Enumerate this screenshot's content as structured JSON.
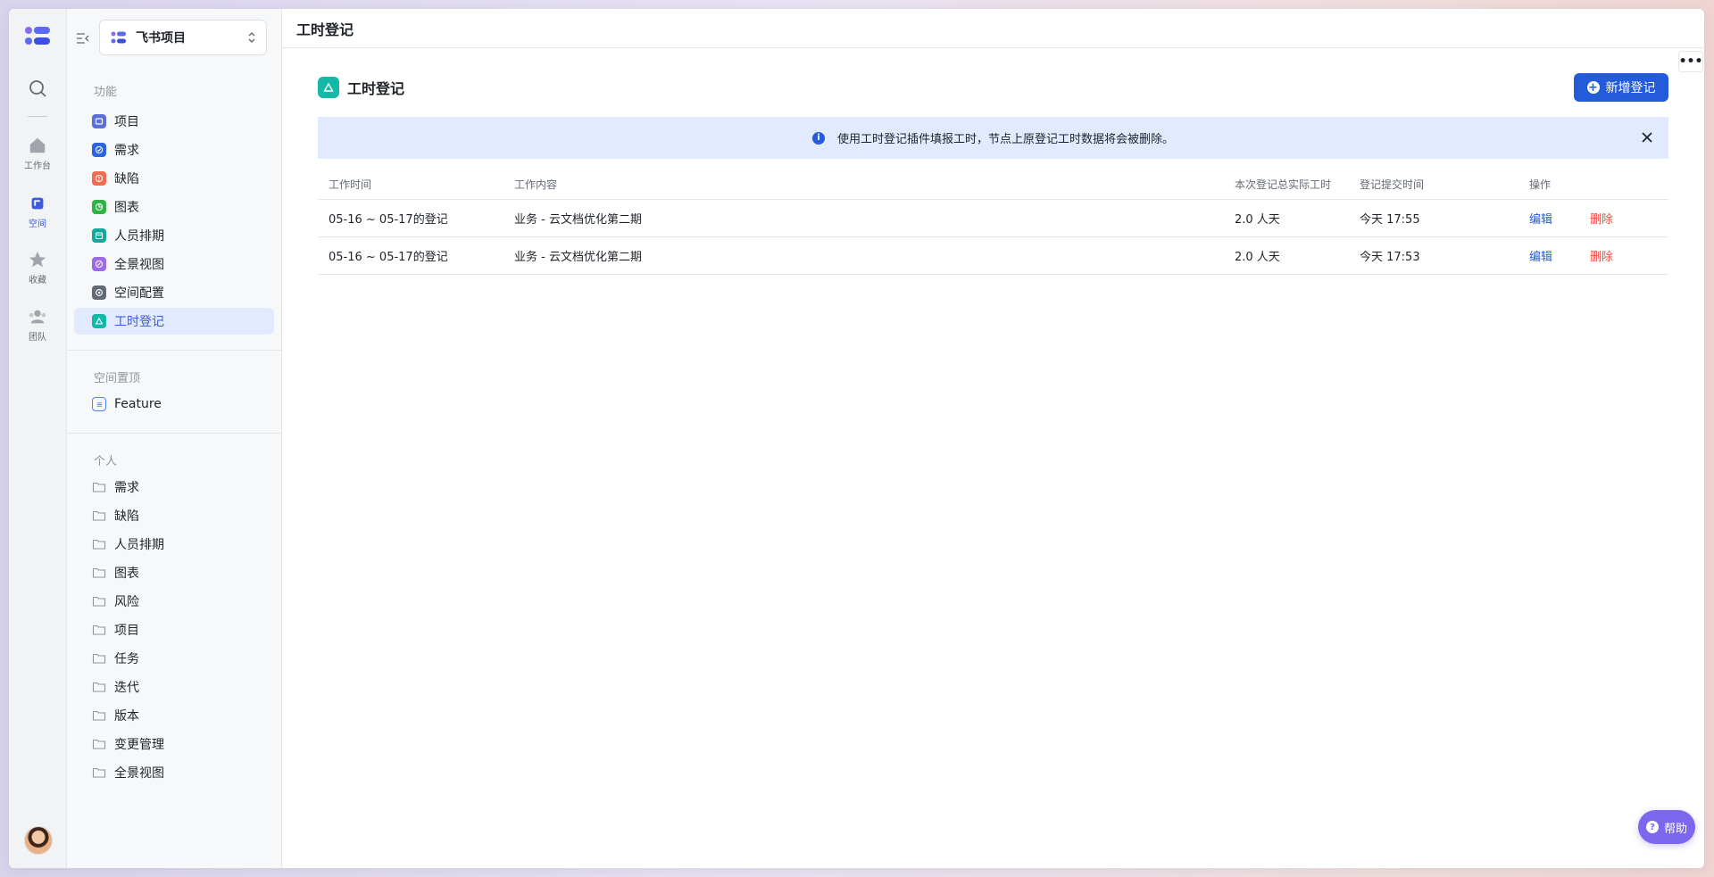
{
  "rail": {
    "items": [
      {
        "label": "工作台"
      },
      {
        "label": "空间"
      },
      {
        "label": "收藏"
      },
      {
        "label": "团队"
      }
    ]
  },
  "sidebar": {
    "project_name": "飞书项目",
    "section_features": "功能",
    "features": [
      {
        "label": "项目",
        "color": "#5b6fd8"
      },
      {
        "label": "需求",
        "color": "#2a64e0"
      },
      {
        "label": "缺陷",
        "color": "#f26a4f"
      },
      {
        "label": "图表",
        "color": "#2fb344"
      },
      {
        "label": "人员排期",
        "color": "#14a89a"
      },
      {
        "label": "全景视图",
        "color": "#9a6ae8"
      },
      {
        "label": "空间配置",
        "color": "#646a73"
      },
      {
        "label": "工时登记",
        "color": "#14b8a6"
      }
    ],
    "section_pinned": "空间置顶",
    "pinned": [
      {
        "label": "Feature"
      }
    ],
    "section_personal": "个人",
    "personal": [
      {
        "label": "需求"
      },
      {
        "label": "缺陷"
      },
      {
        "label": "人员排期"
      },
      {
        "label": "图表"
      },
      {
        "label": "风险"
      },
      {
        "label": "项目"
      },
      {
        "label": "任务"
      },
      {
        "label": "迭代"
      },
      {
        "label": "版本"
      },
      {
        "label": "变更管理"
      },
      {
        "label": "全景视图"
      }
    ]
  },
  "header": {
    "title": "工时登记"
  },
  "page": {
    "title": "工时登记",
    "add_button": "新增登记",
    "banner": "使用工时登记插件填报工时，节点上原登记工时数据将会被删除。"
  },
  "table": {
    "columns": [
      "工作时间",
      "工作内容",
      "本次登记总实际工时",
      "登记提交时间",
      "操作"
    ],
    "rows": [
      {
        "time": "05-16 ~ 05-17的登记",
        "content": "业务 - 云文档优化第二期",
        "hours": "2.0 人天",
        "submitted": "今天 17:55",
        "edit": "编辑",
        "delete": "删除"
      },
      {
        "time": "05-16 ~ 05-17的登记",
        "content": "业务 - 云文档优化第二期",
        "hours": "2.0 人天",
        "submitted": "今天 17:53",
        "edit": "编辑",
        "delete": "删除"
      }
    ]
  },
  "help": {
    "label": "帮助"
  },
  "colors": {
    "accent": "#245bdb",
    "danger": "#f54a45",
    "banner_bg": "#e1eaff",
    "help_bg": "#7b68ee"
  }
}
